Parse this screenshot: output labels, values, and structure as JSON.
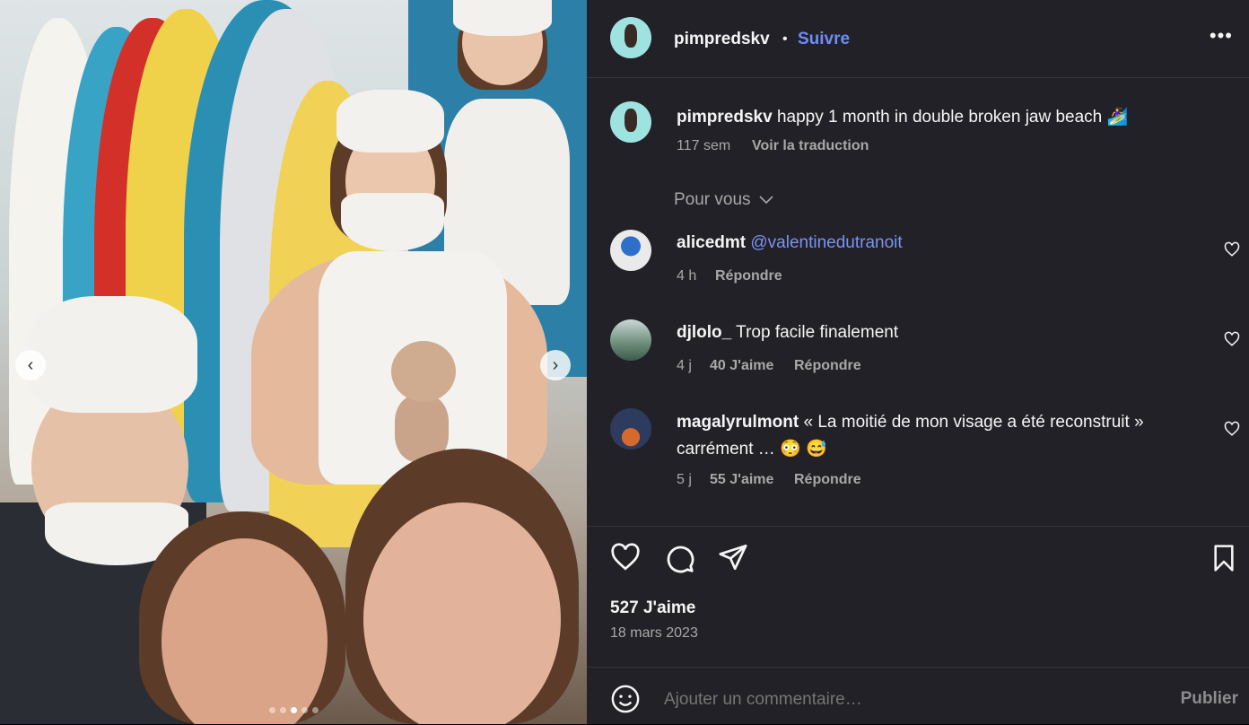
{
  "post": {
    "username": "pimpredskv",
    "follow_label": "Suivre",
    "separator": "•",
    "more_label": "•••",
    "caption_text": "happy 1 month in double broken jaw beach 🏄‍♀️",
    "caption_age": "117 sem",
    "translate_label": "Voir la traduction"
  },
  "filter": {
    "label": "Pour vous"
  },
  "comments": [
    {
      "user": "alicedmt",
      "text": "@valentinedutranoit",
      "age": "4 h",
      "likes": "",
      "reply": "Répondre"
    },
    {
      "user": "djlolo_",
      "text": "Trop facile finalement",
      "age": "4 j",
      "likes": "40 J'aime",
      "reply": "Répondre"
    },
    {
      "user": "magalyrulmont",
      "text": "« La moitié de mon visage a été reconstruit »",
      "text2": "carrément … 😳 😅",
      "age": "5 j",
      "likes": "55 J'aime",
      "reply": "Répondre"
    }
  ],
  "stats": {
    "likes": "527 J'aime",
    "date": "18 mars 2023"
  },
  "composer": {
    "placeholder": "Ajouter un commentaire…",
    "publish_label": "Publier"
  },
  "carousel": {
    "slide_count": 5,
    "active_index": 2
  },
  "colors": {
    "panel": "#222127",
    "accent": "#6e8df7",
    "muted": "#a8a8a8"
  }
}
